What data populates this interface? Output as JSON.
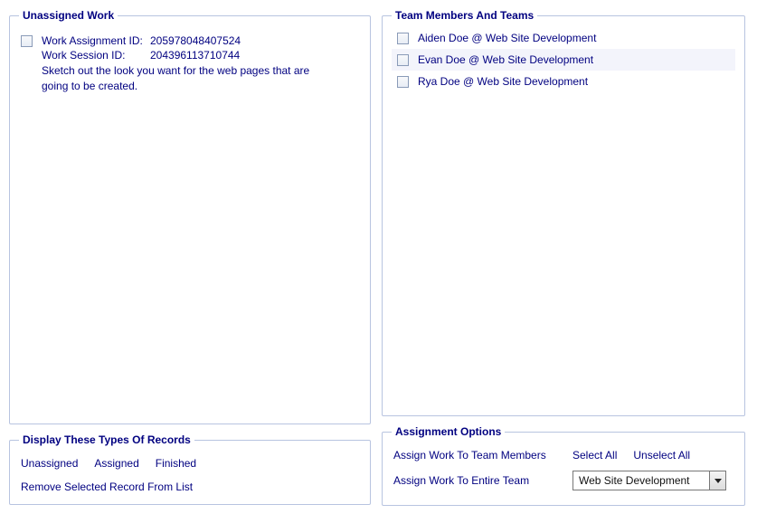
{
  "left": {
    "unassigned_legend": "Unassigned Work",
    "work_item": {
      "assignment_label": "Work Assignment ID:",
      "assignment_value": "205978048407524",
      "session_label": "Work Session ID:",
      "session_value": "204396113710744",
      "description": "Sketch out the look you want for the web pages that are going to be created."
    },
    "display_legend": "Display These Types Of Records",
    "filters": {
      "unassigned": "Unassigned",
      "assigned": "Assigned",
      "finished": "Finished"
    },
    "remove_link": "Remove Selected Record From List"
  },
  "right": {
    "team_legend": "Team Members And Teams",
    "members": [
      "Aiden Doe @ Web Site Development",
      "Evan Doe @ Web Site Development",
      "Rya Doe @ Web Site Development"
    ],
    "options_legend": "Assignment Options",
    "assign_members": "Assign Work To Team Members",
    "select_all": "Select All",
    "unselect_all": "Unselect All",
    "assign_team": "Assign Work To Entire Team",
    "team_dropdown_value": "Web Site Development"
  }
}
